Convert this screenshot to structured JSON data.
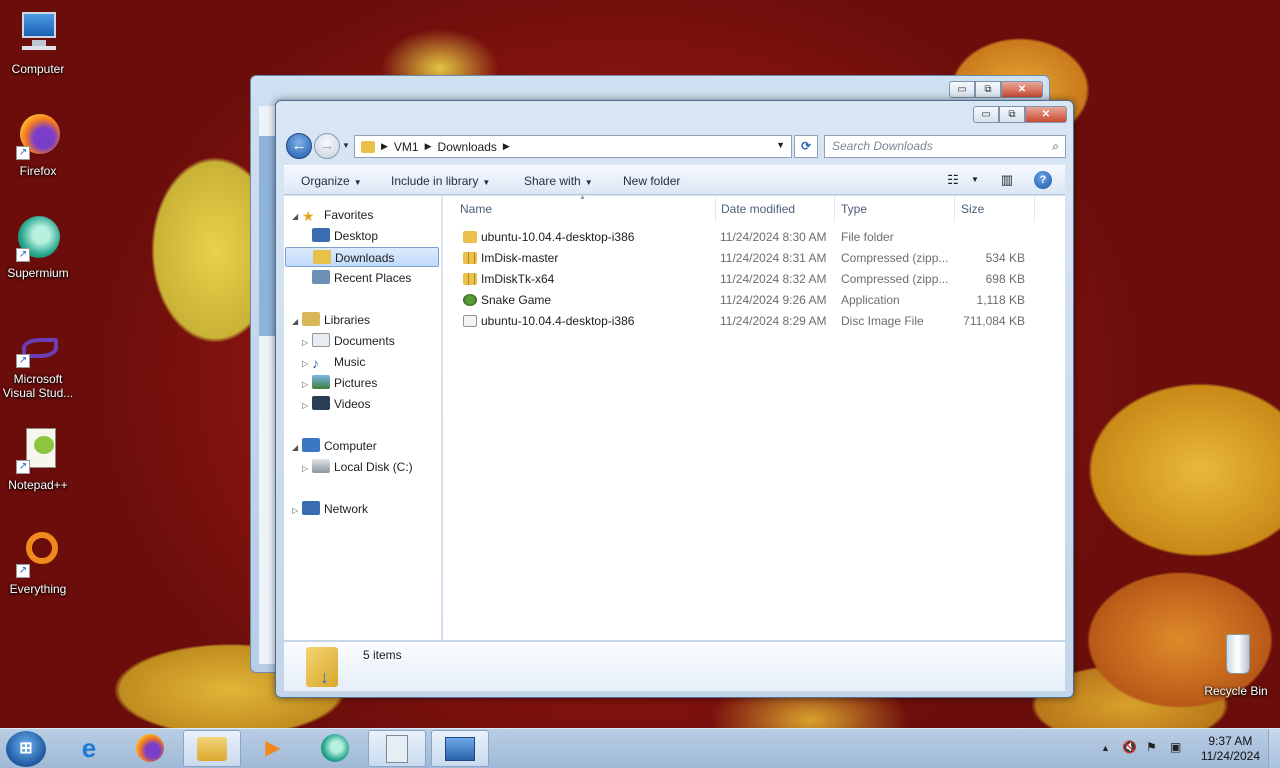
{
  "desktop": {
    "icons": [
      {
        "label": "Computer"
      },
      {
        "label": "Firefox"
      },
      {
        "label": "Supermium"
      },
      {
        "label": "Microsoft Visual Stud..."
      },
      {
        "label": "Notepad++"
      },
      {
        "label": "Everything"
      },
      {
        "label": "Recycle Bin"
      }
    ]
  },
  "window": {
    "controls": {
      "minimize": "▭",
      "maximize": "⧉",
      "close": "✕"
    },
    "address": {
      "crumbs": [
        "VM1",
        "Downloads"
      ]
    },
    "search": {
      "placeholder": "Search Downloads"
    },
    "toolbar": {
      "organize": "Organize",
      "include": "Include in library",
      "share": "Share with",
      "new_folder": "New folder"
    },
    "nav": {
      "favorites": "Favorites",
      "desktop": "Desktop",
      "downloads": "Downloads",
      "recent": "Recent Places",
      "libraries": "Libraries",
      "documents": "Documents",
      "music": "Music",
      "pictures": "Pictures",
      "videos": "Videos",
      "computer": "Computer",
      "local_disk": "Local Disk (C:)",
      "network": "Network"
    },
    "columns": {
      "name": "Name",
      "date": "Date modified",
      "type": "Type",
      "size": "Size"
    },
    "files": [
      {
        "name": "ubuntu-10.04.4-desktop-i386",
        "date": "11/24/2024 8:30 AM",
        "type": "File folder",
        "size": ""
      },
      {
        "name": "ImDisk-master",
        "date": "11/24/2024 8:31 AM",
        "type": "Compressed (zipp...",
        "size": "534 KB"
      },
      {
        "name": "ImDiskTk-x64",
        "date": "11/24/2024 8:32 AM",
        "type": "Compressed (zipp...",
        "size": "698 KB"
      },
      {
        "name": "Snake Game",
        "date": "11/24/2024 9:26 AM",
        "type": "Application",
        "size": "1,118 KB"
      },
      {
        "name": "ubuntu-10.04.4-desktop-i386",
        "date": "11/24/2024 8:29 AM",
        "type": "Disc Image File",
        "size": "711,084 KB"
      }
    ],
    "status": {
      "items": "5 items"
    }
  },
  "taskbar": {
    "clock_time": "9:37 AM",
    "clock_date": "11/24/2024",
    "tray_arrow": "▲"
  },
  "colors": {
    "accent": "#1d5aa8",
    "selection": "#c1dbfc",
    "folder": "#e8c04a"
  }
}
